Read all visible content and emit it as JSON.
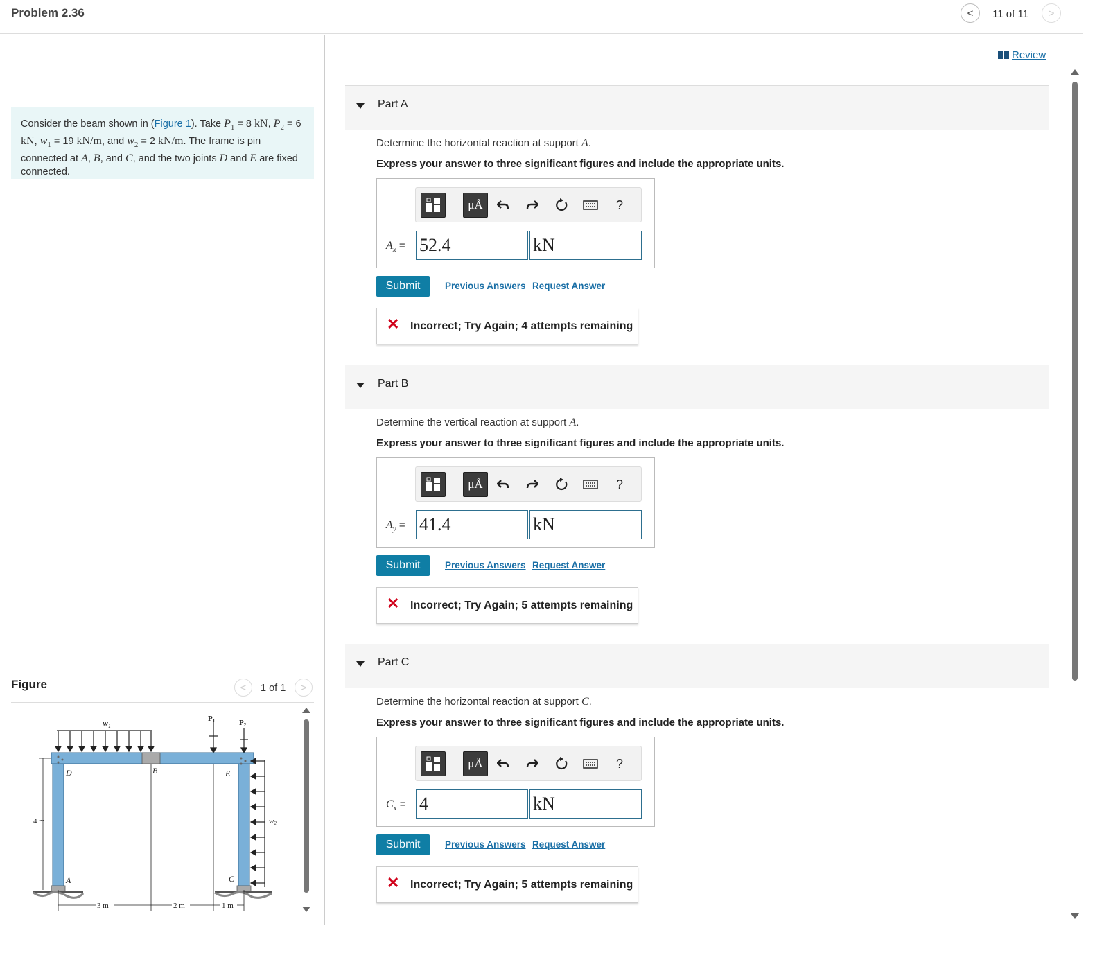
{
  "header": {
    "title": "Problem 2.36",
    "counter": "11 of 11",
    "prev_glyph": "<",
    "next_glyph": ">"
  },
  "review": {
    "label": "Review"
  },
  "intro": {
    "t1": "Consider the beam shown in (",
    "figure_link": "Figure 1",
    "t2": "). Take ",
    "p1_sym": "P",
    "p1_sub": "1",
    "p1_val": " = 8 ",
    "kn": "kN",
    "p2_sym": "P",
    "p2_sub": "2",
    "p2_val": " = 6 ",
    "w1_sym": "w",
    "w1_sub": "1",
    "w1_val": " = 19 ",
    "knm": "kN/m",
    "and1": ", and ",
    "w2_sym": "w",
    "w2_sub": "2",
    "w2_val": " = 2 ",
    "t3": ". The frame is pin connected at ",
    "A": "A",
    "B": "B",
    "and2": ", and ",
    "C": "C",
    "t4": ", and the two joints ",
    "D": "D",
    "and3": " and ",
    "E": "E",
    "t5": " are fixed connected."
  },
  "figure": {
    "label": "Figure",
    "counter": "1 of 1",
    "labels": {
      "w1": "w",
      "w1_sub": "1",
      "p1": "P",
      "p1_sub": "1",
      "p2": "P",
      "p2_sub": "2",
      "D": "D",
      "B": "B",
      "E": "E",
      "A": "A",
      "C": "C",
      "w2": "w",
      "w2_sub": "2",
      "h": "4 m",
      "d1": "3 m",
      "d2": "2 m",
      "d3": "1 m"
    }
  },
  "toolbar": {
    "units_glyph": "μÅ",
    "help": "?"
  },
  "parts": [
    {
      "title": "Part A",
      "q_pre": "Determine the horizontal reaction at support ",
      "q_var": "A",
      "instruction": "Express your answer to three significant figures and include the appropriate units.",
      "var_sym": "A",
      "var_sub": "x",
      "equals": " =",
      "value": "52.4",
      "unit": "kN",
      "submit": "Submit",
      "prev": "Previous Answers",
      "request": "Request Answer",
      "feedback": "Incorrect; Try Again; 4 attempts remaining"
    },
    {
      "title": "Part B",
      "q_pre": "Determine the vertical reaction at support ",
      "q_var": "A",
      "instruction": "Express your answer to three significant figures and include the appropriate units.",
      "var_sym": "A",
      "var_sub": "y",
      "equals": " =",
      "value": "41.4",
      "unit": "kN",
      "submit": "Submit",
      "prev": "Previous Answers",
      "request": "Request Answer",
      "feedback": "Incorrect; Try Again; 5 attempts remaining"
    },
    {
      "title": "Part C",
      "q_pre": "Determine the horizontal reaction at support ",
      "q_var": "C",
      "instruction": "Express your answer to three significant figures and include the appropriate units.",
      "var_sym": "C",
      "var_sub": "x",
      "equals": " =",
      "value": "4",
      "unit": "kN",
      "submit": "Submit",
      "prev": "Previous Answers",
      "request": "Request Answer",
      "feedback": "Incorrect; Try Again; 5 attempts remaining"
    }
  ],
  "colors": {
    "accent": "#0f7ea5",
    "link": "#1a6fa6",
    "error": "#d0021b",
    "intro_bg": "#e9f6f7",
    "beam": "#7ab0d8"
  }
}
